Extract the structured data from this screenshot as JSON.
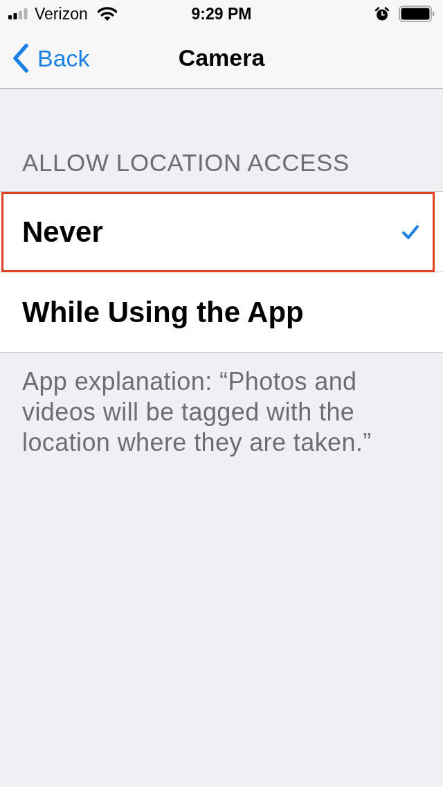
{
  "status_bar": {
    "carrier": "Verizon",
    "time": "9:29 PM"
  },
  "nav_bar": {
    "back": "Back",
    "title": "Camera"
  },
  "section": {
    "header": "ALLOW LOCATION ACCESS",
    "options": [
      {
        "label": "Never",
        "selected": true,
        "highlighted": true
      },
      {
        "label": "While Using the App",
        "selected": false,
        "highlighted": false
      }
    ],
    "footer": "App explanation: “Photos and videos will be tagged with the location where they are taken.”"
  }
}
